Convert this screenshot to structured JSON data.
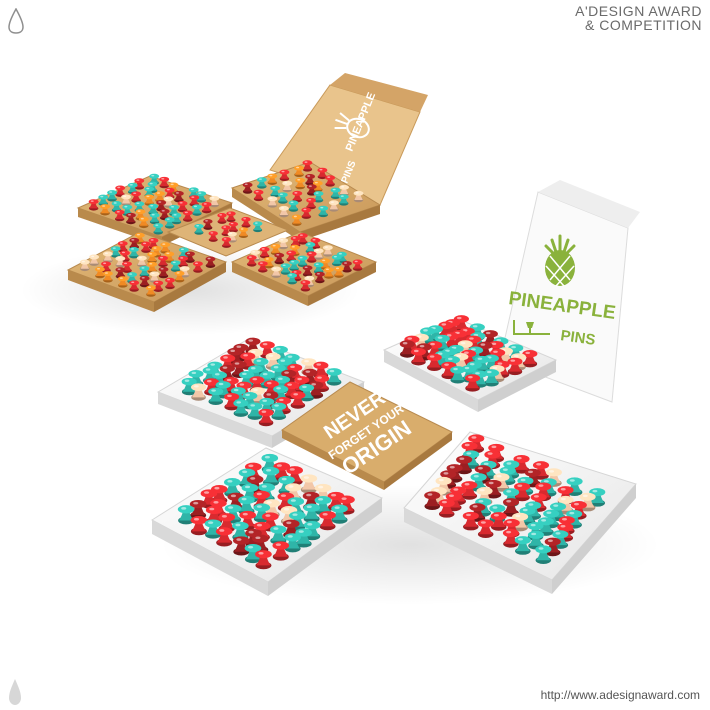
{
  "watermark": {
    "line1": "A'DESIGN AWARD",
    "line2": "& COMPETITION"
  },
  "footer": {
    "url": "http://www.adesignaward.com"
  },
  "product": {
    "brand_word1": "PINEAPPLE",
    "brand_word2": "PINS",
    "slogan_line1": "NEVER",
    "slogan_line2": "FORGET YOUR",
    "slogan_line3": "ORIGIN"
  },
  "colors": {
    "kraft": "#d9ad6c",
    "kraft_dark": "#b98a4c",
    "white_box": "#f4f4f4",
    "pin_red": "#d82a2f",
    "pin_teal": "#2fb5a8",
    "pin_peach": "#f2c7a8",
    "pin_dark_red": "#9c1f22",
    "pin_orange": "#f08a24",
    "pineapple_green": "#8ab23c"
  }
}
